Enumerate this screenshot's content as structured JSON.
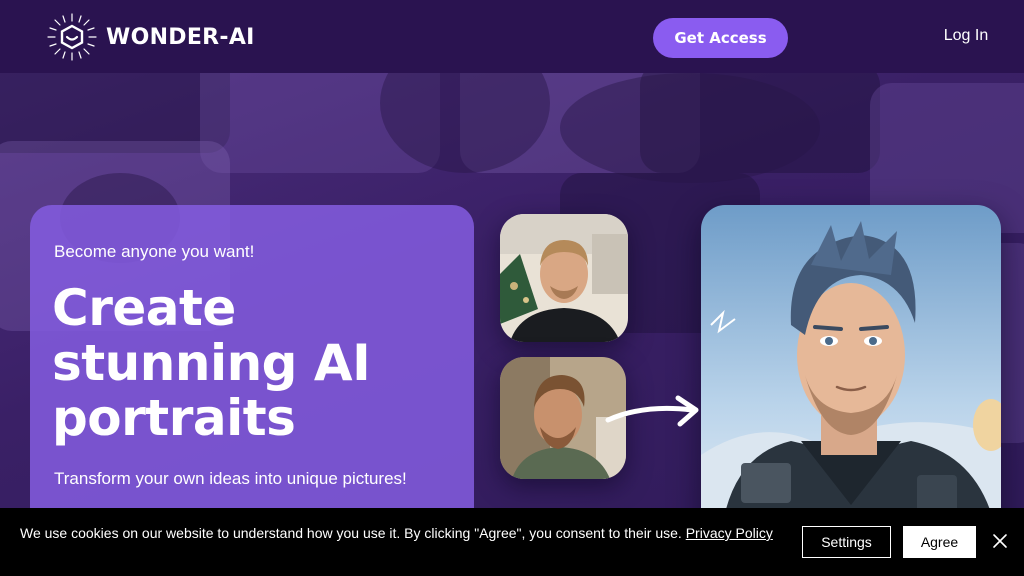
{
  "header": {
    "brand": "WONDER-AI",
    "get_access_label": "Get Access",
    "login_label": "Log In"
  },
  "hero": {
    "tagline": "Become anyone you want!",
    "headline": "Create stunning AI portraits",
    "subtitle": "Transform your own ideas into unique pictures!"
  },
  "cookie_banner": {
    "text": "We use cookies on our website to understand how you use it. By clicking \"Agree\", you consent to their use.",
    "link_label": "Privacy Policy",
    "settings_label": "Settings",
    "agree_label": "Agree"
  },
  "colors": {
    "header_bg": "#2a1350",
    "accent": "#8a5cf0",
    "card_bg": "#845ce0",
    "cookie_bg": "#000000"
  },
  "icons": [
    "logo-icon",
    "arrow-icon",
    "close-icon"
  ]
}
